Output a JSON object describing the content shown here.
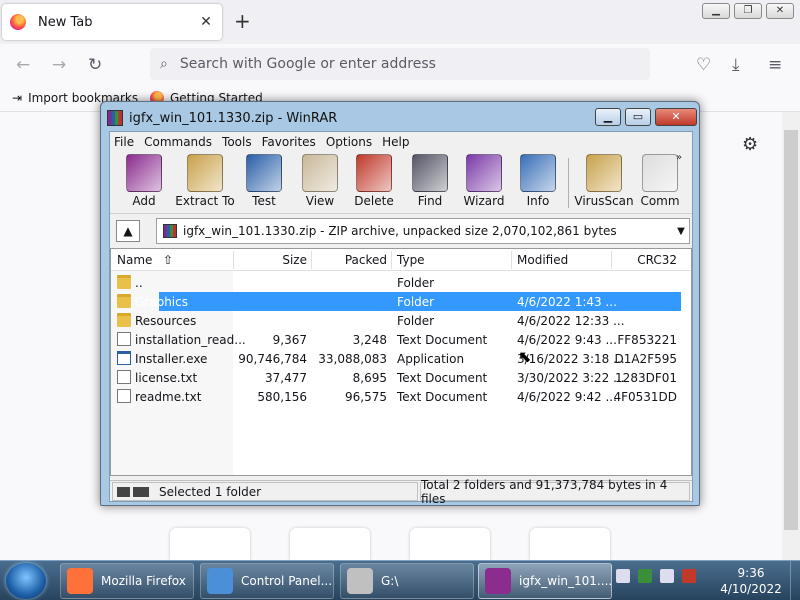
{
  "firefox": {
    "tab_title": "New Tab",
    "tab_close": "✕",
    "new_tab": "+",
    "search_placeholder": "Search with Google or enter address",
    "bookmarks": [
      "Import bookmarks",
      "Getting Started"
    ],
    "window_controls": {
      "minimize": "▁",
      "maximize": "❐",
      "close": "✕"
    }
  },
  "winrar": {
    "title": "igfx_win_101.1330.zip - WinRAR",
    "controls": {
      "minimize": "▁",
      "maximize": "▭",
      "close": "✕"
    },
    "menu": [
      "File",
      "Commands",
      "Tools",
      "Favorites",
      "Options",
      "Help"
    ],
    "toolbar": [
      {
        "label": "Add",
        "color": "#8b2c8f"
      },
      {
        "label": "Extract To",
        "color": "#c9a24a"
      },
      {
        "label": "Test",
        "color": "#2a5fa8"
      },
      {
        "label": "View",
        "color": "#c8b898"
      },
      {
        "label": "Delete",
        "color": "#c0392b"
      },
      {
        "label": "Find",
        "color": "#556"
      },
      {
        "label": "Wizard",
        "color": "#7b3aa8"
      },
      {
        "label": "Info",
        "color": "#3a6fb8"
      },
      {
        "label": "VirusScan",
        "color": "#c9a24a"
      },
      {
        "label": "Comm",
        "color": "#ddd"
      }
    ],
    "toolbar_more": "»",
    "address": "igfx_win_101.1330.zip - ZIP archive, unpacked size 2,070,102,861 bytes",
    "address_dropdown": "▼",
    "up_button": "▲",
    "columns": {
      "name": "Name",
      "name_sort": "⇧",
      "size": "Size",
      "packed": "Packed",
      "type": "Type",
      "modified": "Modified",
      "crc": "CRC32"
    },
    "files": [
      {
        "name": "..",
        "size": "",
        "packed": "",
        "type": "Folder",
        "modified": "",
        "crc": "",
        "icon": "folder"
      },
      {
        "name": "Graphics",
        "size": "",
        "packed": "",
        "type": "Folder",
        "modified": "4/6/2022 1:43 ...",
        "crc": "",
        "icon": "folder",
        "selected": true
      },
      {
        "name": "Resources",
        "size": "",
        "packed": "",
        "type": "Folder",
        "modified": "4/6/2022 12:33 ...",
        "crc": "",
        "icon": "folder"
      },
      {
        "name": "installation_read...",
        "size": "9,367",
        "packed": "3,248",
        "type": "Text Document",
        "modified": "4/6/2022 9:43 ...",
        "crc": "FF853221",
        "icon": "doc"
      },
      {
        "name": "Installer.exe",
        "size": "90,746,784",
        "packed": "33,088,083",
        "type": "Application",
        "modified": "3/16/2022 3:18 ...",
        "crc": "D1A2F595",
        "icon": "exe"
      },
      {
        "name": "license.txt",
        "size": "37,477",
        "packed": "8,695",
        "type": "Text Document",
        "modified": "3/30/2022 3:22 ...",
        "crc": "1283DF01",
        "icon": "doc"
      },
      {
        "name": "readme.txt",
        "size": "580,156",
        "packed": "96,575",
        "type": "Text Document",
        "modified": "4/6/2022 9:42 ...",
        "crc": "4F0531DD",
        "icon": "doc"
      }
    ],
    "status_left": "Selected 1 folder",
    "status_right": "Total 2 folders and 91,373,784 bytes in 4 files"
  },
  "taskbar": {
    "buttons": [
      {
        "label": "Mozilla Firefox",
        "icon_color": "#ff7139"
      },
      {
        "label": "Control Panel...",
        "icon_color": "#4a8fd8"
      },
      {
        "label": "G:\\",
        "icon_color": "#c0c0c0"
      },
      {
        "label": "igfx_win_101....",
        "icon_color": "#8b2c8f",
        "active": true
      }
    ],
    "tray_colors": [
      "#dde",
      "#3b8f3b",
      "#dde",
      "#c0392b"
    ],
    "time": "9:36",
    "date": "4/10/2022"
  }
}
